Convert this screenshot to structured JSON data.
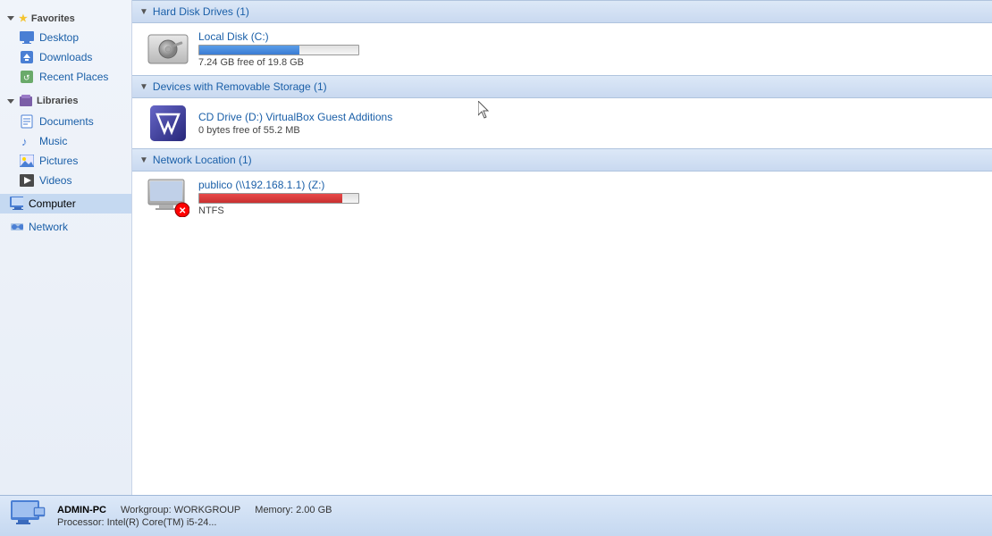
{
  "sidebar": {
    "favorites_label": "Favorites",
    "items_favorites": [
      {
        "id": "desktop",
        "label": "Desktop",
        "icon": "desktop-icon"
      },
      {
        "id": "downloads",
        "label": "Downloads",
        "icon": "downloads-icon"
      },
      {
        "id": "recent",
        "label": "Recent Places",
        "icon": "recent-icon"
      }
    ],
    "libraries_label": "Libraries",
    "items_libraries": [
      {
        "id": "documents",
        "label": "Documents",
        "icon": "documents-icon"
      },
      {
        "id": "music",
        "label": "Music",
        "icon": "music-icon"
      },
      {
        "id": "pictures",
        "label": "Pictures",
        "icon": "pictures-icon"
      },
      {
        "id": "videos",
        "label": "Videos",
        "icon": "videos-icon"
      }
    ],
    "computer_label": "Computer",
    "network_label": "Network"
  },
  "content": {
    "sections": [
      {
        "id": "hard-disk-drives",
        "title": "Hard Disk Drives (1)",
        "items": [
          {
            "id": "local-disk-c",
            "name": "Local Disk (C:)",
            "size_info": "7.24 GB free of 19.8 GB",
            "progress_pct": 63,
            "progress_type": "blue",
            "icon": "hdd-icon"
          }
        ]
      },
      {
        "id": "removable-storage",
        "title": "Devices with Removable Storage (1)",
        "items": [
          {
            "id": "cd-drive-d",
            "name": "CD Drive (D:) VirtualBox Guest Additions",
            "size_info": "0 bytes free of 55.2 MB",
            "progress_pct": null,
            "progress_type": null,
            "icon": "cd-icon"
          }
        ]
      },
      {
        "id": "network-location",
        "title": "Network Location (1)",
        "items": [
          {
            "id": "publico-z",
            "name": "publico (\\\\192.168.1.1) (Z:)",
            "size_info": "NTFS",
            "progress_pct": 90,
            "progress_type": "red",
            "icon": "network-icon"
          }
        ]
      }
    ]
  },
  "status_bar": {
    "pc_name": "ADMIN-PC",
    "workgroup": "Workgroup: WORKGROUP",
    "memory": "Memory: 2.00 GB",
    "processor": "Processor: Intel(R) Core(TM) i5-24..."
  }
}
